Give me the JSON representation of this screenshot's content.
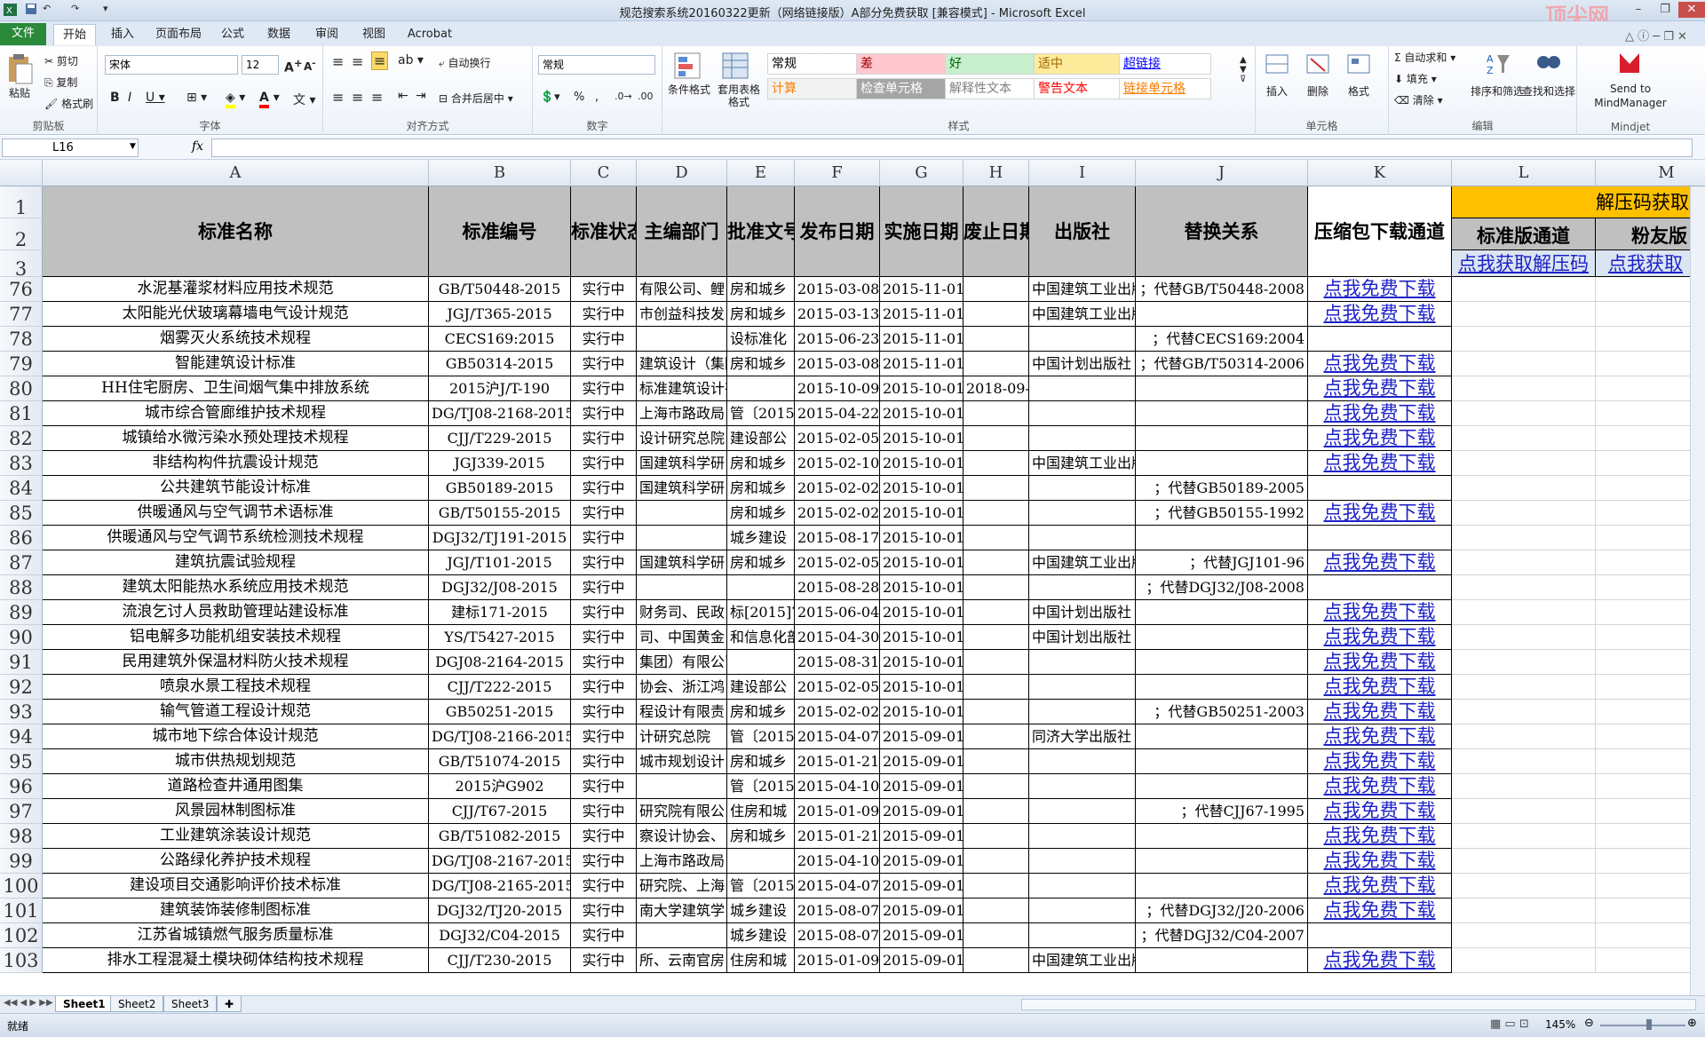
{
  "window": {
    "title": "规范搜索系统20160322更新（网络链接版）A部分免费获取  [兼容模式] - Microsoft Excel",
    "watermark": "顶尖网"
  },
  "tabs": [
    "文件",
    "开始",
    "插入",
    "页面布局",
    "公式",
    "数据",
    "审阅",
    "视图",
    "Acrobat"
  ],
  "ribbon": {
    "clipboard": {
      "paste": "粘贴",
      "cut": "剪切",
      "copy": "复制",
      "format_painter": "格式刷",
      "group": "剪贴板"
    },
    "font": {
      "name": "宋体",
      "size": "12",
      "group": "字体"
    },
    "align": {
      "wrap": "自动换行",
      "merge": "合并后居中",
      "group": "对齐方式"
    },
    "number": {
      "format": "常规",
      "group": "数字"
    },
    "styles": {
      "cond_format": "条件格式",
      "table_format": "套用表格格式",
      "cells": [
        {
          "label": "常规",
          "bg": "#ffffff",
          "color": "#000000"
        },
        {
          "label": "差",
          "bg": "#ffc7ce",
          "color": "#9c0006"
        },
        {
          "label": "好",
          "bg": "#c6efce",
          "color": "#006100"
        },
        {
          "label": "适中",
          "bg": "#ffeb9c",
          "color": "#9c6500"
        },
        {
          "label": "超链接",
          "bg": "#ffffff",
          "color": "#0000ff"
        },
        {
          "label": "计算",
          "bg": "#f2f2f2",
          "color": "#fa7d00"
        },
        {
          "label": "检查单元格",
          "bg": "#a5a5a5",
          "color": "#ffffff"
        },
        {
          "label": "解释性文本",
          "bg": "#ffffff",
          "color": "#7f7f7f"
        },
        {
          "label": "警告文本",
          "bg": "#ffffff",
          "color": "#ff0000"
        },
        {
          "label": "链接单元格",
          "bg": "#ffffff",
          "color": "#fa7d00"
        }
      ],
      "group": "样式"
    },
    "cells": {
      "insert": "插入",
      "delete": "删除",
      "format": "格式",
      "group": "单元格"
    },
    "editing": {
      "autosum": "自动求和",
      "fill": "填充",
      "clear": "清除",
      "sort": "排序和筛选",
      "find": "查找和选择",
      "group": "编辑"
    },
    "mindjet": {
      "send": "Send to MindManager",
      "group": "Mindjet"
    }
  },
  "formula_bar": {
    "name_box": "L16",
    "fx": "fx",
    "value": ""
  },
  "columns": [
    "A",
    "B",
    "C",
    "D",
    "E",
    "F",
    "G",
    "H",
    "I",
    "J",
    "K",
    "L",
    "M"
  ],
  "header": {
    "row_numbers": [
      "1",
      "2",
      "3"
    ],
    "A": "标准名称",
    "B": "标准编号",
    "C": "标准状态",
    "D": "主编部门",
    "E": "批准文号",
    "F": "发布日期",
    "G": "实施日期",
    "H": "废止日期",
    "I": "出版社",
    "J": "替换关系",
    "K": "压缩包下载通道",
    "L1": "解压码获取通道",
    "L2": "标准版通道",
    "M2": "粉友版",
    "L3": "点我获取解压码",
    "M3": "点我获取"
  },
  "link_text": "点我免费下载",
  "rows": [
    {
      "n": "76",
      "A": "水泥基灌浆材料应用技术规范",
      "B": "GB/T50448-2015",
      "C": "实行中",
      "D": "有限公司、鲤",
      "E": "房和城乡",
      "F": "2015-03-08",
      "G": "2015-11-01",
      "H": "",
      "I": "中国建筑工业出版",
      "J": "；代替GB/T50448-2008",
      "K": true
    },
    {
      "n": "77",
      "A": "太阳能光伏玻璃幕墙电气设计规范",
      "B": "JGJ/T365-2015",
      "C": "实行中",
      "D": "市创益科技发",
      "E": "房和城乡",
      "F": "2015-03-13",
      "G": "2015-11-01",
      "H": "",
      "I": "中国建筑工业出版",
      "J": "",
      "K": true
    },
    {
      "n": "78",
      "A": "烟雾灭火系统技术规程",
      "B": "CECS169:2015",
      "C": "实行中",
      "D": "",
      "E": "设标准化",
      "F": "2015-06-23",
      "G": "2015-11-01",
      "H": "",
      "I": "",
      "J": "；代替CECS169:2004",
      "K": false
    },
    {
      "n": "79",
      "A": "智能建筑设计标准",
      "B": "GB50314-2015",
      "C": "实行中",
      "D": "建筑设计（集团",
      "E": "房和城乡",
      "F": "2015-03-08",
      "G": "2015-11-01",
      "H": "",
      "I": "中国计划出版社",
      "J": "；代替GB/T50314-2006",
      "K": true
    },
    {
      "n": "80",
      "A": "HH住宅厨房、卫生间烟气集中排放系统",
      "B": "2015沪J/T-190",
      "C": "实行中",
      "D": "标准建筑设计有",
      "E": "",
      "F": "2015-10-09",
      "G": "2015-10-01",
      "H": "2018-09-0",
      "I": "",
      "J": "",
      "K": true
    },
    {
      "n": "81",
      "A": "城市综合管廊维护技术规程",
      "B": "DG/TJ08-2168-2015",
      "C": "实行中",
      "D": "上海市路政局",
      "E": "管〔2015〕",
      "F": "2015-04-22",
      "G": "2015-10-01",
      "H": "",
      "I": "",
      "J": "",
      "K": true
    },
    {
      "n": "82",
      "A": "城镇给水微污染水预处理技术规程",
      "B": "CJJ/T229-2015",
      "C": "实行中",
      "D": "设计研究总院",
      "E": "建设部公",
      "F": "2015-02-05",
      "G": "2015-10-01",
      "H": "",
      "I": "",
      "J": "",
      "K": true
    },
    {
      "n": "83",
      "A": "非结构构件抗震设计规范",
      "B": "JGJ339-2015",
      "C": "实行中",
      "D": "国建筑科学研",
      "E": "房和城乡",
      "F": "2015-02-10",
      "G": "2015-10-01",
      "H": "",
      "I": "中国建筑工业出版",
      "J": "",
      "K": true
    },
    {
      "n": "84",
      "A": "公共建筑节能设计标准",
      "B": "GB50189-2015",
      "C": "实行中",
      "D": "国建筑科学研",
      "E": "房和城乡",
      "F": "2015-02-02",
      "G": "2015-10-01",
      "H": "",
      "I": "",
      "J": "；代替GB50189-2005",
      "K": false
    },
    {
      "n": "85",
      "A": "供暖通风与空气调节术语标准",
      "B": "GB/T50155-2015",
      "C": "实行中",
      "D": "",
      "E": "房和城乡",
      "F": "2015-02-02",
      "G": "2015-10-01",
      "H": "",
      "I": "",
      "J": "；代替GB50155-1992",
      "K": true
    },
    {
      "n": "86",
      "A": "供暖通风与空气调节系统检测技术规程",
      "B": "DGJ32/TJ191-2015",
      "C": "实行中",
      "D": "",
      "E": "城乡建设",
      "F": "2015-08-17",
      "G": "2015-10-01",
      "H": "",
      "I": "",
      "J": "",
      "K": false
    },
    {
      "n": "87",
      "A": "建筑抗震试验规程",
      "B": "JGJ/T101-2015",
      "C": "实行中",
      "D": "国建筑科学研",
      "E": "房和城乡",
      "F": "2015-02-05",
      "G": "2015-10-01",
      "H": "",
      "I": "中国建筑工业出版",
      "J": "；代替JGJ101-96",
      "K": true
    },
    {
      "n": "88",
      "A": "建筑太阳能热水系统应用技术规范",
      "B": "DGJ32/J08-2015",
      "C": "实行中",
      "D": "",
      "E": "",
      "F": "2015-08-28",
      "G": "2015-10-01",
      "H": "",
      "I": "",
      "J": "；代替DGJ32/J08-2008",
      "K": false
    },
    {
      "n": "89",
      "A": "流浪乞讨人员救助管理站建设标准",
      "B": "建标171-2015",
      "C": "实行中",
      "D": "财务司、民政",
      "E": "标[2015]7",
      "F": "2015-06-04",
      "G": "2015-10-01",
      "H": "",
      "I": "中国计划出版社",
      "J": "",
      "K": true
    },
    {
      "n": "90",
      "A": "铝电解多功能机组安装技术规程",
      "B": "YS/T5427-2015",
      "C": "实行中",
      "D": "司、中国黄金",
      "E": "和信息化部",
      "F": "2015-04-30",
      "G": "2015-10-01",
      "H": "",
      "I": "中国计划出版社",
      "J": "",
      "K": true
    },
    {
      "n": "91",
      "A": "民用建筑外保温材料防火技术规程",
      "B": "DGJ08-2164-2015",
      "C": "实行中",
      "D": "集团）有限公司",
      "E": "",
      "F": "2015-08-31",
      "G": "2015-10-01",
      "H": "",
      "I": "",
      "J": "",
      "K": true
    },
    {
      "n": "92",
      "A": "喷泉水景工程技术规程",
      "B": "CJJ/T222-2015",
      "C": "实行中",
      "D": "协会、浙江鸿",
      "E": "建设部公",
      "F": "2015-02-05",
      "G": "2015-10-01",
      "H": "",
      "I": "",
      "J": "",
      "K": true
    },
    {
      "n": "93",
      "A": "输气管道工程设计规范",
      "B": "GB50251-2015",
      "C": "实行中",
      "D": "程设计有限责",
      "E": "房和城乡",
      "F": "2015-02-02",
      "G": "2015-10-01",
      "H": "",
      "I": "",
      "J": "；代替GB50251-2003",
      "K": true
    },
    {
      "n": "94",
      "A": "城市地下综合体设计规范",
      "B": "DG/TJ08-2166-2015",
      "C": "实行中",
      "D": "计研究总院",
      "E": "管〔2015〕",
      "F": "2015-04-07",
      "G": "2015-09-01",
      "H": "",
      "I": "同济大学出版社",
      "J": "",
      "K": true
    },
    {
      "n": "95",
      "A": "城市供热规划规范",
      "B": "GB/T51074-2015",
      "C": "实行中",
      "D": "城市规划设计",
      "E": "房和城乡",
      "F": "2015-01-21",
      "G": "2015-09-01",
      "H": "",
      "I": "",
      "J": "",
      "K": true
    },
    {
      "n": "96",
      "A": "道路检查井通用图集",
      "B": "2015沪G902",
      "C": "实行中",
      "D": "",
      "E": "管〔2015〕",
      "F": "2015-04-10",
      "G": "2015-09-01",
      "H": "",
      "I": "",
      "J": "",
      "K": true
    },
    {
      "n": "97",
      "A": "风景园林制图标准",
      "B": "CJJ/T67-2015",
      "C": "实行中",
      "D": "研究院有限公",
      "E": "住房和城",
      "F": "2015-01-09",
      "G": "2015-09-01",
      "H": "",
      "I": "",
      "J": "；代替CJJ67-1995",
      "K": true
    },
    {
      "n": "98",
      "A": "工业建筑涂装设计规范",
      "B": "GB/T51082-2015",
      "C": "实行中",
      "D": "察设计协会、",
      "E": "房和城乡",
      "F": "2015-01-21",
      "G": "2015-09-01",
      "H": "",
      "I": "",
      "J": "",
      "K": true
    },
    {
      "n": "99",
      "A": "公路绿化养护技术规程",
      "B": "DG/TJ08-2167-2015",
      "C": "实行中",
      "D": "上海市路政局",
      "E": "",
      "F": "2015-04-10",
      "G": "2015-09-01",
      "H": "",
      "I": "",
      "J": "",
      "K": true
    },
    {
      "n": "100",
      "A": "建设项目交通影响评价技术标准",
      "B": "DG/TJ08-2165-2015",
      "C": "实行中",
      "D": "研究院、上海",
      "E": "管〔2015〕",
      "F": "2015-04-07",
      "G": "2015-09-01",
      "H": "",
      "I": "",
      "J": "",
      "K": true
    },
    {
      "n": "101",
      "A": "建筑装饰装修制图标准",
      "B": "DGJ32/TJ20-2015",
      "C": "实行中",
      "D": "南大学建筑学",
      "E": "城乡建设",
      "F": "2015-08-07",
      "G": "2015-09-01",
      "H": "",
      "I": "",
      "J": "；代替DGJ32/J20-2006",
      "K": true
    },
    {
      "n": "102",
      "A": "江苏省城镇燃气服务质量标准",
      "B": "DGJ32/C04-2015",
      "C": "实行中",
      "D": "",
      "E": "城乡建设",
      "F": "2015-08-07",
      "G": "2015-09-01",
      "H": "",
      "I": "",
      "J": "；代替DGJ32/C04-2007",
      "K": false
    },
    {
      "n": "103",
      "A": "排水工程混凝土模块砌体结构技术规程",
      "B": "CJJ/T230-2015",
      "C": "实行中",
      "D": "所、云南官房",
      "E": "住房和城",
      "F": "2015-01-09",
      "G": "2015-09-01",
      "H": "",
      "I": "中国建筑工业出版",
      "J": "",
      "K": true
    }
  ],
  "sheets": [
    "Sheet1",
    "Sheet2",
    "Sheet3"
  ],
  "status": {
    "ready": "就绪",
    "zoom": "145%"
  },
  "colors": {
    "header_gray": "#c0c0c0",
    "orange": "#ffc000",
    "link": "#1d22c8",
    "file_tab": "#2a8a3a"
  }
}
